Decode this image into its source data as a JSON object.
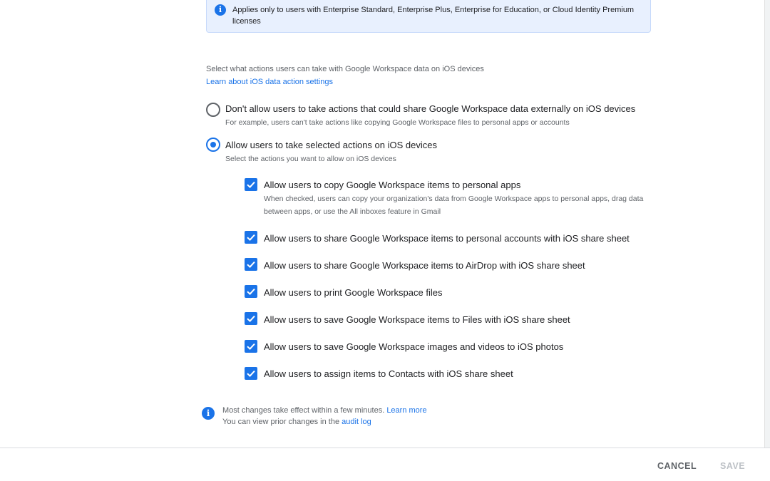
{
  "notice": {
    "icon": "info-icon",
    "text": "Applies only to users with Enterprise Standard, Enterprise Plus, Enterprise for Education, or Cloud Identity Premium licenses"
  },
  "section": {
    "description": "Select what actions users can take with Google Workspace data on iOS devices",
    "learn_link": "Learn about iOS data action settings"
  },
  "radio_options": [
    {
      "label": "Don't allow users to take actions that could share Google Workspace data externally on iOS devices",
      "help": "For example, users can't take actions like copying Google Workspace files to personal apps or accounts",
      "selected": false
    },
    {
      "label": "Allow users to take selected actions on iOS devices",
      "help": "Select the actions you want to allow on iOS devices",
      "selected": true
    }
  ],
  "checkboxes": [
    {
      "label": "Allow users to copy Google Workspace items to personal apps",
      "help": "When checked, users can copy your organization's data from Google Workspace apps to personal apps, drag data between apps, or use the All inboxes feature in Gmail",
      "checked": true
    },
    {
      "label": "Allow users to share Google Workspace items to personal accounts with iOS share sheet",
      "checked": true
    },
    {
      "label": "Allow users to share Google Workspace items to AirDrop with iOS share sheet",
      "checked": true
    },
    {
      "label": "Allow users to print Google Workspace files",
      "checked": true
    },
    {
      "label": "Allow users to save Google Workspace items to Files with iOS share sheet",
      "checked": true
    },
    {
      "label": "Allow users to save Google Workspace images and videos to iOS photos",
      "checked": true
    },
    {
      "label": "Allow users to assign items to Contacts with iOS share sheet",
      "checked": true
    }
  ],
  "footer_note": {
    "icon": "info-icon",
    "line1_text": "Most changes take effect within a few minutes.",
    "line1_link": "Learn more",
    "line2_text": "You can view prior changes in the",
    "line2_link": "audit log"
  },
  "actions": {
    "cancel_label": "CANCEL",
    "save_label": "SAVE"
  },
  "colors": {
    "accent": "#1a73e8",
    "notice_bg": "#e8f0fe",
    "secondary_text": "#5f6368",
    "disabled_text": "#bdc1c6"
  }
}
